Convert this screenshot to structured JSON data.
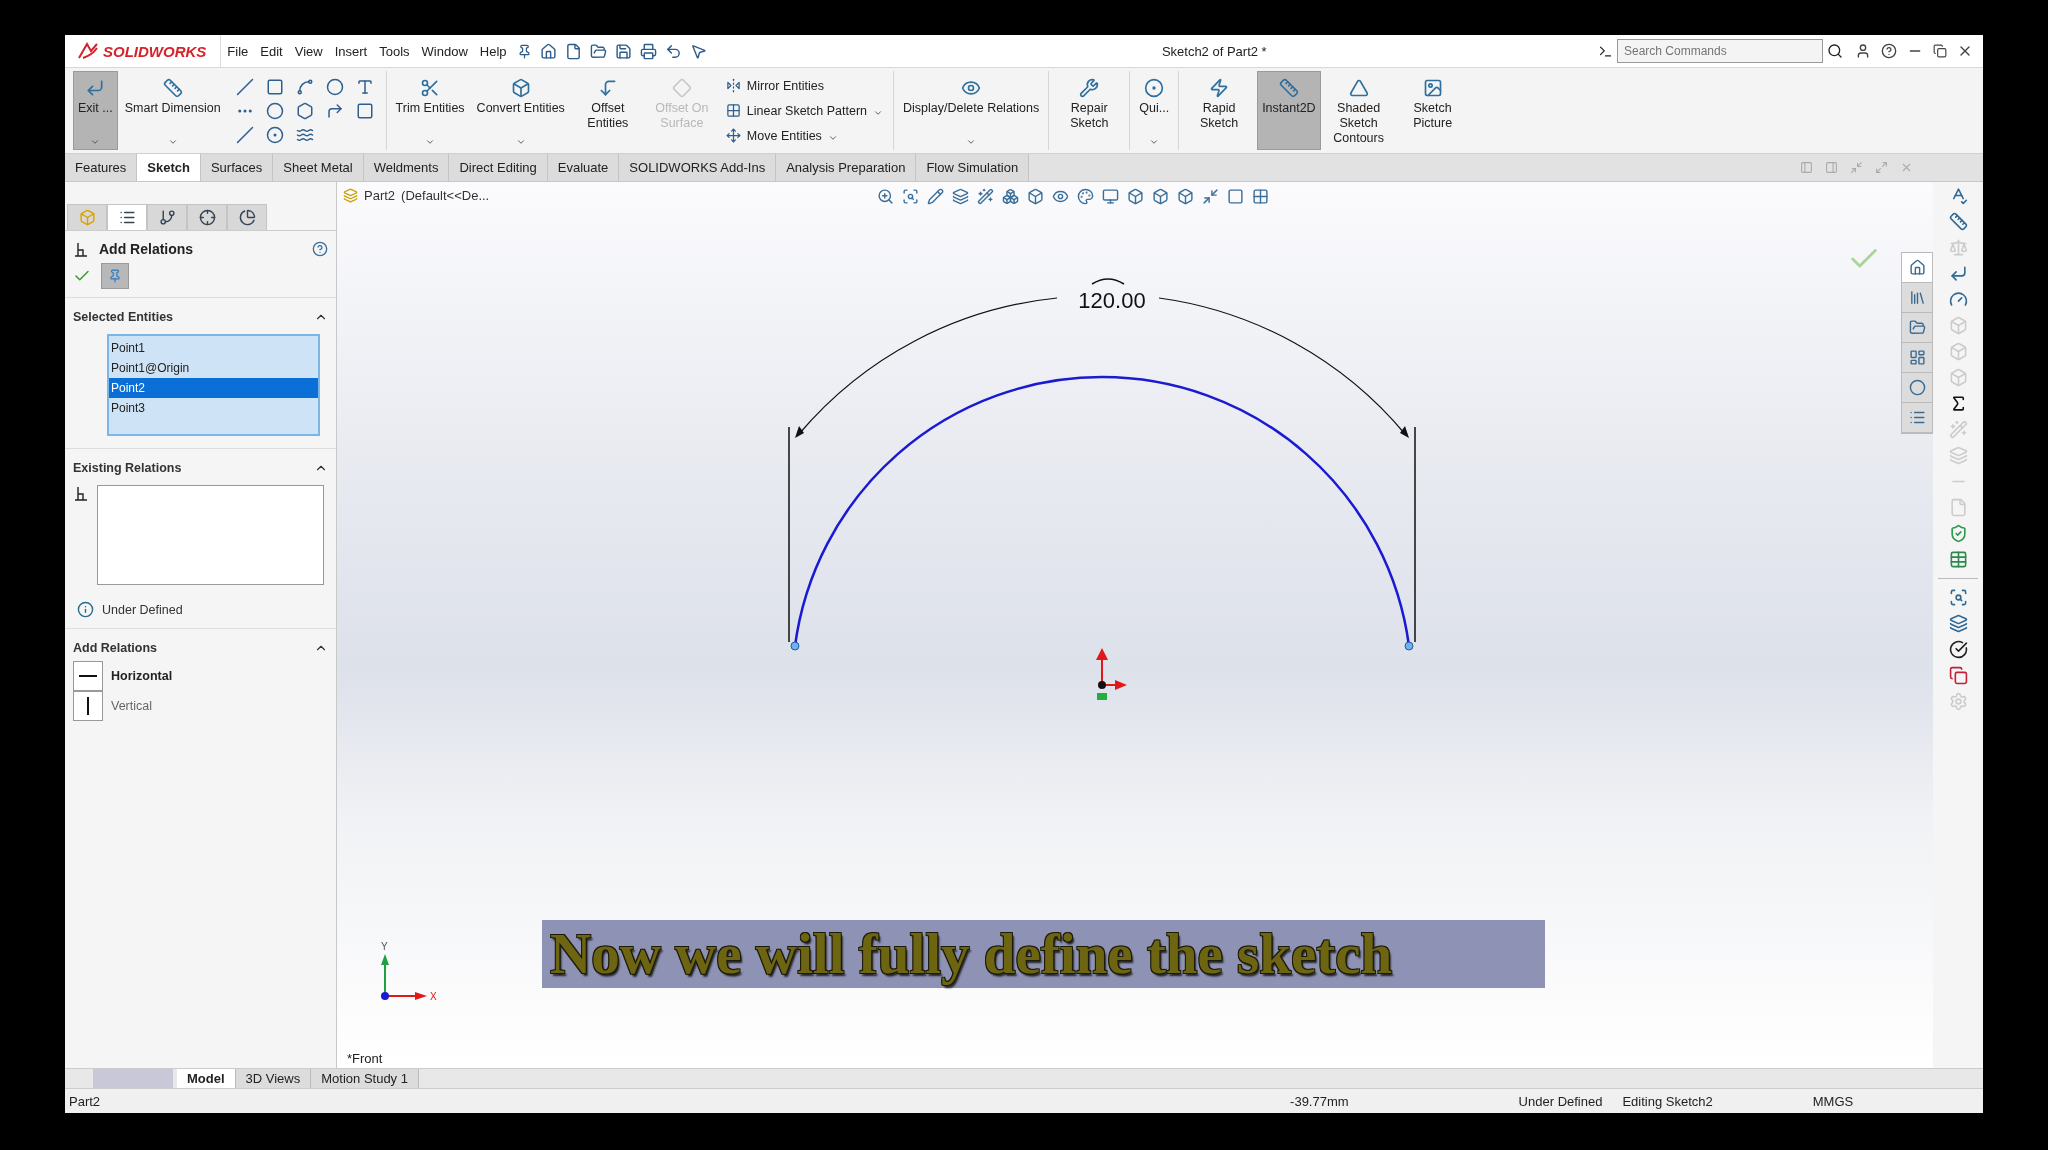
{
  "app": {
    "name": "SOLIDWORKS"
  },
  "menu": [
    "File",
    "Edit",
    "View",
    "Insert",
    "Tools",
    "Window",
    "Help"
  ],
  "title": "Sketch2 of Part2 *",
  "search": {
    "placeholder": "Search Commands"
  },
  "command_groups": [
    [
      {
        "kind": "tall",
        "label": "Exit ...",
        "selected": true,
        "disabled": false,
        "dropdown": true
      },
      {
        "kind": "wide",
        "label": "Smart Dimension",
        "selected": false,
        "disabled": false,
        "dropdown": true
      },
      {
        "kind": "grid"
      }
    ],
    [
      {
        "kind": "wide",
        "label": "Trim Entities",
        "selected": false,
        "disabled": false,
        "dropdown": true
      },
      {
        "kind": "wide",
        "label": "Convert Entities",
        "selected": false,
        "disabled": false,
        "dropdown": true
      },
      {
        "kind": "tall",
        "label": "Offset Entities",
        "selected": false,
        "disabled": false
      },
      {
        "kind": "tall",
        "label": "Offset On Surface",
        "selected": false,
        "disabled": true
      },
      {
        "kind": "stack",
        "items": [
          {
            "label": "Mirror Entities"
          },
          {
            "label": "Linear Sketch Pattern",
            "dropdown": true
          },
          {
            "label": "Move Entities",
            "dropdown": true
          }
        ]
      }
    ],
    [
      {
        "kind": "wide",
        "label": "Display/Delete Relations",
        "selected": false,
        "disabled": false,
        "dropdown": true
      }
    ],
    [
      {
        "kind": "tall",
        "label": "Repair Sketch",
        "selected": false,
        "disabled": false
      }
    ],
    [
      {
        "kind": "tall",
        "label": "Qui...",
        "selected": false,
        "disabled": false,
        "dropdown": true
      }
    ],
    [
      {
        "kind": "tall",
        "label": "Rapid Sketch",
        "selected": false,
        "disabled": false
      },
      {
        "kind": "tall",
        "label": "Instant2D",
        "selected": true,
        "disabled": false
      },
      {
        "kind": "tall",
        "label": "Shaded Sketch Contours",
        "selected": false,
        "disabled": false
      },
      {
        "kind": "tall",
        "label": "Sketch Picture",
        "selected": false,
        "disabled": false
      }
    ]
  ],
  "tabs": [
    {
      "label": "Features",
      "selected": false
    },
    {
      "label": "Sketch",
      "selected": true
    },
    {
      "label": "Surfaces",
      "selected": false
    },
    {
      "label": "Sheet Metal",
      "selected": false
    },
    {
      "label": "Weldments",
      "selected": false
    },
    {
      "label": "Direct Editing",
      "selected": false
    },
    {
      "label": "Evaluate",
      "selected": false
    },
    {
      "label": "SOLIDWORKS Add-Ins",
      "selected": false
    },
    {
      "label": "Analysis Preparation",
      "selected": false
    },
    {
      "label": "Flow Simulation",
      "selected": false
    }
  ],
  "panel_tabs": [
    {
      "selected": false
    },
    {
      "selected": true
    },
    {
      "selected": false
    },
    {
      "selected": false
    },
    {
      "selected": false
    }
  ],
  "property_manager": {
    "title": "Add Relations",
    "selected_entities": {
      "heading": "Selected Entities",
      "items": [
        {
          "label": "Point1",
          "selected": false
        },
        {
          "label": "Point1@Origin",
          "selected": false
        },
        {
          "label": "Point2",
          "selected": true
        },
        {
          "label": "Point3",
          "selected": false
        }
      ]
    },
    "existing_relations": {
      "heading": "Existing Relations",
      "status": "Under Defined"
    },
    "add_relations": {
      "heading": "Add Relations",
      "options": [
        {
          "label": "Horizontal",
          "highlighted": true
        },
        {
          "label": "Vertical",
          "highlighted": false
        }
      ]
    }
  },
  "viewport": {
    "breadcrumb": {
      "part": "Part2",
      "config": "(Default<<De..."
    },
    "dimension": "120.00",
    "triad": {
      "x": "X",
      "y": "Y"
    },
    "view_name": "*Front",
    "caption": "Now we will fully define the sketch"
  },
  "task_pane_tabs": [
    {
      "selected": true
    },
    {
      "selected": false
    },
    {
      "selected": false
    },
    {
      "selected": false
    },
    {
      "selected": false
    },
    {
      "selected": false
    }
  ],
  "bottom_tabs": [
    {
      "label": "Model",
      "selected": true
    },
    {
      "label": "3D Views",
      "selected": false
    },
    {
      "label": "Motion Study 1",
      "selected": false
    }
  ],
  "status_bar": {
    "document": "Part2",
    "coordinate": "-39.77mm",
    "state": "Under Defined",
    "mode": "Editing Sketch2",
    "units": "MMGS"
  }
}
